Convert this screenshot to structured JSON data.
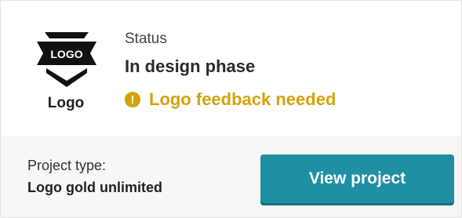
{
  "logo": {
    "badge_text": "LOGO",
    "caption": "Logo"
  },
  "status": {
    "label": "Status",
    "value": "In design phase",
    "alert_icon": "!",
    "alert_text": "Logo feedback needed",
    "alert_color": "#d4a20a"
  },
  "project": {
    "type_label": "Project type:",
    "type_value": "Logo gold unlimited"
  },
  "actions": {
    "view_label": "View project",
    "button_color": "#1f8fa5"
  }
}
